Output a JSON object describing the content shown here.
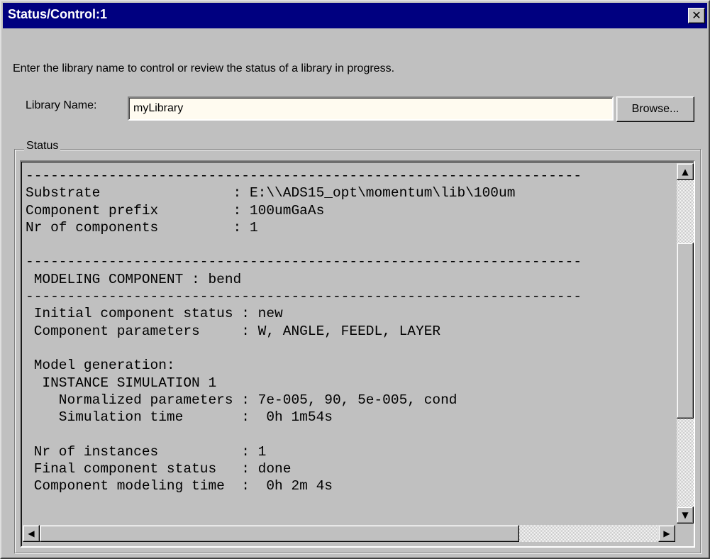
{
  "window": {
    "title": "Status/Control:1",
    "close_glyph": "✕"
  },
  "instructions": "Enter the library name to control or review the status of a library in progress.",
  "library": {
    "label": "Library Name:",
    "value": "myLibrary",
    "browse_label": "Browse..."
  },
  "status": {
    "group_label": "Status",
    "lines": [
      "-------------------------------------------------------------------",
      "Substrate                : E:\\\\ADS15_opt\\momentum\\lib\\100um",
      "Component prefix         : 100umGaAs",
      "Nr of components         : 1",
      "",
      "-------------------------------------------------------------------",
      " MODELING COMPONENT : bend",
      "-------------------------------------------------------------------",
      " Initial component status : new",
      " Component parameters     : W, ANGLE, FEEDL, LAYER",
      "",
      " Model generation:",
      "  INSTANCE SIMULATION 1",
      "    Normalized parameters : 7e-005, 90, 5e-005, cond",
      "    Simulation time       :  0h 1m54s",
      "",
      " Nr of instances          : 1",
      " Final component status   : done",
      " Component modeling time  :  0h 2m 4s"
    ]
  },
  "icons": {
    "up": "▲",
    "down": "▼",
    "left": "◀",
    "right": "▶"
  },
  "colors": {
    "titlebar": "#000080",
    "face": "#c0c0c0",
    "input_bg": "#fffbf0"
  }
}
